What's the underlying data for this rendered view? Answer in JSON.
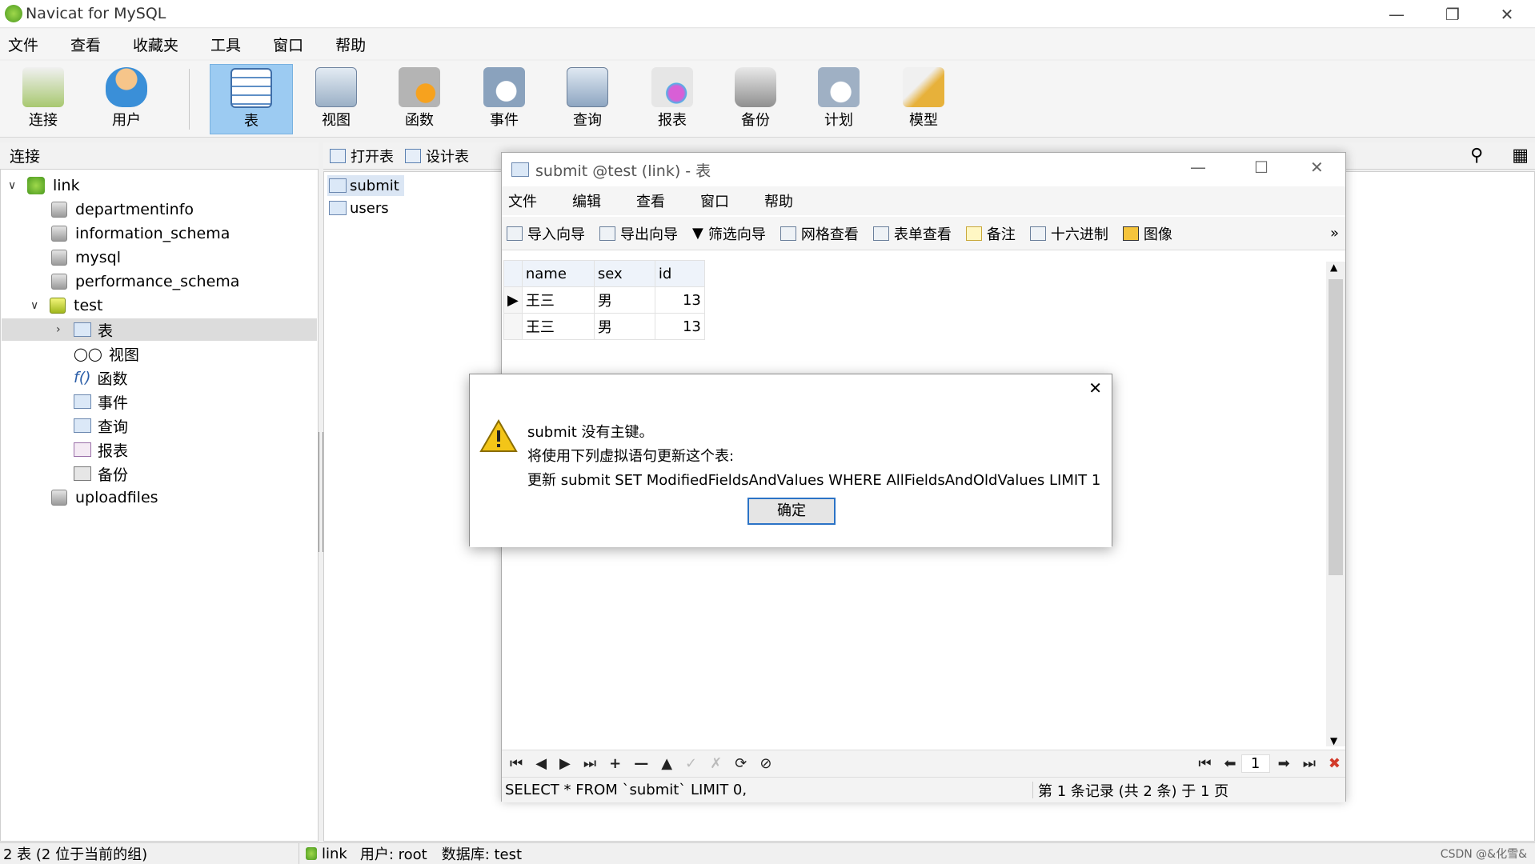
{
  "app": {
    "title": "Navicat for MySQL"
  },
  "menu": [
    "文件",
    "查看",
    "收藏夹",
    "工具",
    "窗口",
    "帮助"
  ],
  "toolbar": [
    "连接",
    "用户",
    "表",
    "视图",
    "函数",
    "事件",
    "查询",
    "报表",
    "备份",
    "计划",
    "模型"
  ],
  "left": {
    "header": "连接",
    "tree": {
      "root": "link",
      "dbs": [
        "departmentinfo",
        "information_schema",
        "mysql",
        "performance_schema"
      ],
      "open_db": "test",
      "children": [
        "表",
        "视图",
        "函数",
        "事件",
        "查询",
        "报表",
        "备份"
      ],
      "last_db": "uploadfiles"
    }
  },
  "objtoolbar": [
    "打开表",
    "设计表"
  ],
  "objects": [
    "submit",
    "users"
  ],
  "status": {
    "count": "2 表 (2 位于当前的组)",
    "connection": "link",
    "user": "用户: root",
    "database": "数据库: test",
    "watermark": "CSDN @&化雪&"
  },
  "inner": {
    "title": "submit @test (link) - 表",
    "menu": [
      "文件",
      "编辑",
      "查看",
      "窗口",
      "帮助"
    ],
    "tools": [
      "导入向导",
      "导出向导",
      "筛选向导",
      "网格查看",
      "表单查看",
      "备注",
      "十六进制",
      "图像"
    ],
    "columns": [
      "name",
      "sex",
      "id"
    ],
    "rows": [
      [
        "王三",
        "男",
        "13"
      ],
      [
        "王三",
        "男",
        "13"
      ]
    ],
    "sql": "SELECT * FROM `submit` LIMIT 0,",
    "record": "第 1 条记录 (共 2 条) 于 1 页",
    "page": "1"
  },
  "dialog": {
    "line1": "submit 没有主键。",
    "line2": "将使用下列虚拟语句更新这个表:",
    "line3": "更新 submit SET ModifiedFieldsAndValues WHERE AllFieldsAndOldValues LIMIT 1",
    "ok": "确定"
  }
}
